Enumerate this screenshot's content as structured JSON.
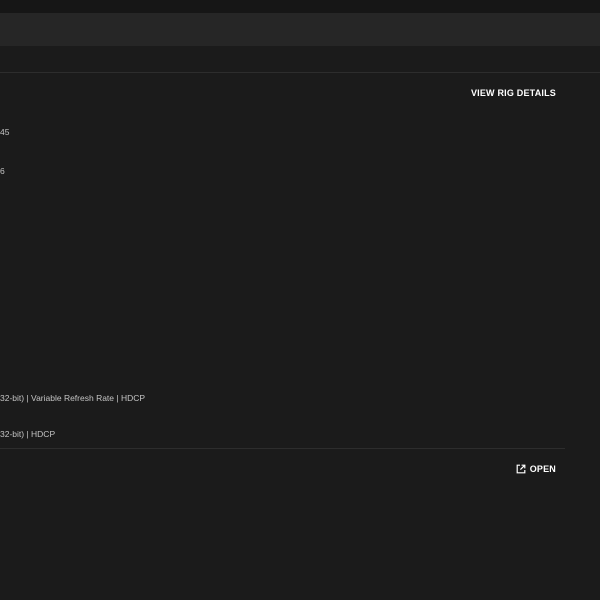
{
  "actions": {
    "view_rig_details": "VIEW RIG DETAILS",
    "open": "OPEN"
  },
  "specs": {
    "line1": "45",
    "line2": "6",
    "line3": "32-bit) | Variable Refresh Rate | HDCP",
    "line4": "32-bit) | HDCP"
  },
  "icons": {
    "open": "external-link-icon"
  },
  "colors": {
    "background": "#1b1b1b",
    "header": "#262626",
    "text_primary": "#ffffff",
    "text_secondary": "#c4c4c4"
  }
}
